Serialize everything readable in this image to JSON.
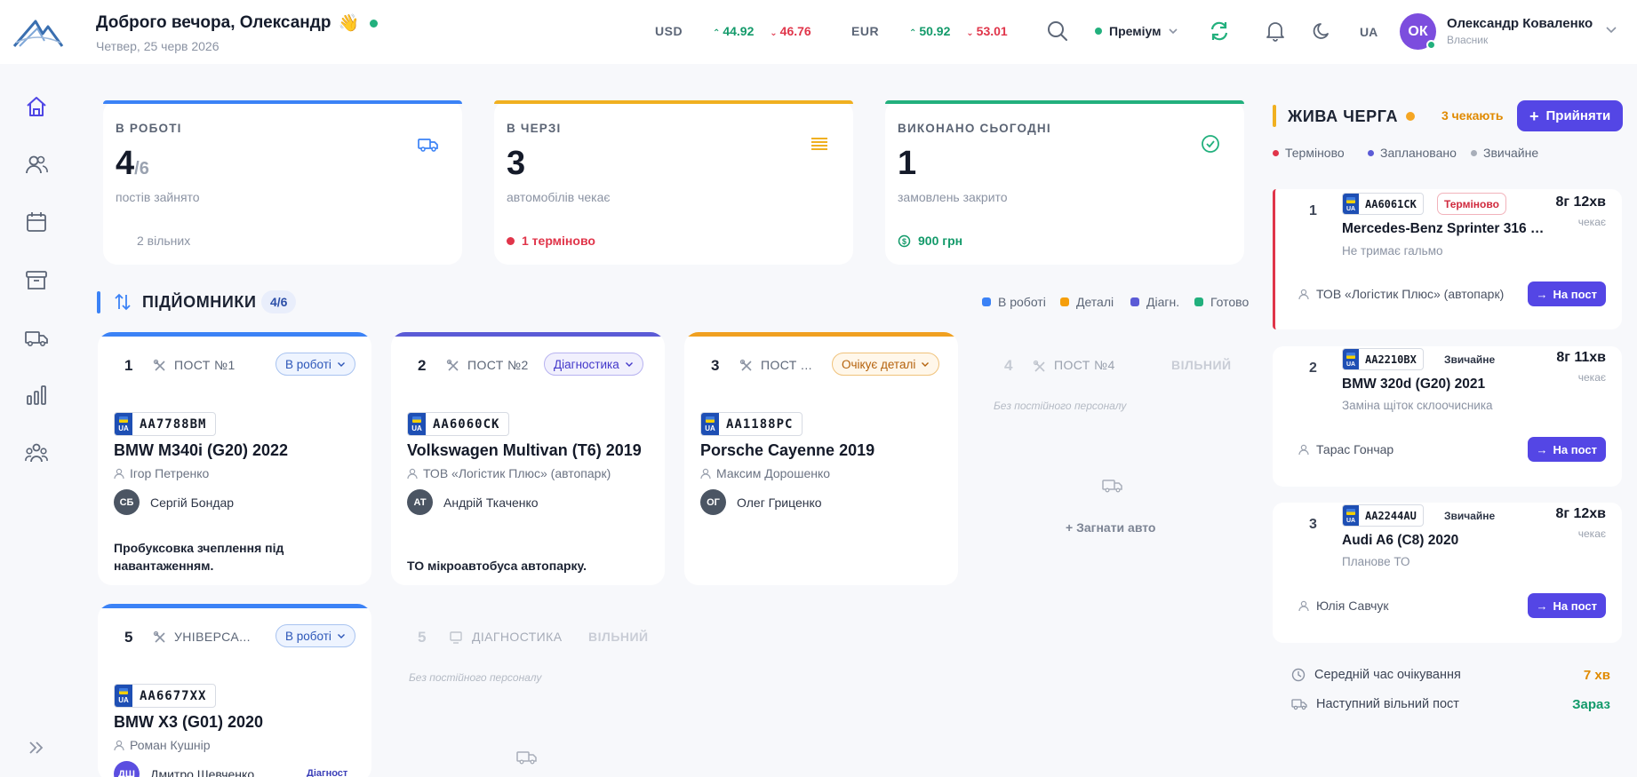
{
  "header": {
    "greeting": "Доброго вечора, Олександр",
    "wave": "👋",
    "date": "Четвер, 25 черв 2026",
    "currencies": [
      {
        "code": "USD",
        "buy": "44.92",
        "sell": "46.76"
      },
      {
        "code": "EUR",
        "buy": "50.92",
        "sell": "53.01"
      }
    ],
    "plan": "Преміум",
    "lang": "UA",
    "user": {
      "initials": "ОК",
      "name": "Олександр Коваленко",
      "role": "Власник"
    }
  },
  "stats": [
    {
      "label": "В РОБОТІ",
      "value": "4",
      "total": "/6",
      "sub": "постів зайнято",
      "foot": "2 вільних",
      "color": "#3b82f6",
      "icon": "truck-icon"
    },
    {
      "label": "В ЧЕРЗІ",
      "value": "3",
      "total": "",
      "sub": "автомобілів чекає",
      "foot": "1 терміново",
      "color": "#f0b020",
      "icon": "queue-list-icon"
    },
    {
      "label": "ВИКОНАНО СЬОГОДНІ",
      "value": "1",
      "total": "",
      "sub": "замовлень закрито",
      "foot": "900 грн",
      "color": "#22b07d",
      "icon": "check-circle-icon"
    }
  ],
  "lifts": {
    "title": "ПІДЙОМНИКИ",
    "count": "4/6",
    "legend": [
      "В роботі",
      "Деталі",
      "Діагн.",
      "Готово"
    ],
    "legend_colors": [
      "#3b82f6",
      "#f59e0b",
      "#5b5bd6",
      "#22b07d"
    ],
    "posts": [
      {
        "num": "1",
        "name": "ПОСТ №1",
        "status": "В роботі",
        "plate": "AA7788BM",
        "car": "BMW M340i (G20) 2022",
        "owner": "Ігор Петренко",
        "mech_initials": "СБ",
        "mech": "Сергій Бондар",
        "note": "Пробуксовка зчеплення під навантаженням."
      },
      {
        "num": "2",
        "name": "ПОСТ №2",
        "status": "Діагностика",
        "plate": "AA6060CK",
        "car": "Volkswagen Multivan (T6) 2019",
        "owner": "ТОВ «Логістик Плюс» (автопарк)",
        "mech_initials": "АТ",
        "mech": "Андрій Ткаченко",
        "note": "ТО мікроавтобуса автопарку."
      },
      {
        "num": "3",
        "name": "ПОСТ ...",
        "status": "Очікує деталі",
        "plate": "AA1188PC",
        "car": "Porsche Cayenne 2019",
        "owner": "Максим Дорошенко",
        "mech_initials": "ОГ",
        "mech": "Олег Гриценко",
        "note": ""
      },
      {
        "num": "5",
        "name": "УНІВЕРСА...",
        "status": "В роботі",
        "plate": "AA6677XX",
        "car": "BMW X3 (G01) 2020",
        "owner": "Роман Кушнір",
        "mech_initials": "ДШ",
        "mech": "Дмитро Шевченко",
        "tag": "Діагност"
      }
    ],
    "empty_posts": [
      {
        "num": "4",
        "name": "ПОСТ №4",
        "status": "ВІЛЬНИЙ",
        "staff": "Без постійного персоналу",
        "action": "+ Загнати авто"
      },
      {
        "num": "5",
        "name": "ДІАГНОСТИКА",
        "status": "ВІЛЬНИЙ",
        "staff": "Без постійного персоналу"
      }
    ]
  },
  "queue": {
    "title": "ЖИВА ЧЕРГА",
    "waiting": "3 чекають",
    "accept": "Прийняти",
    "legend": [
      "Терміново",
      "Заплановано",
      "Звичайне"
    ],
    "items": [
      {
        "idx": "1",
        "plate": "AA6061CK",
        "priority": "Терміново",
        "time": "8г 12хв",
        "wait_label": "чекає",
        "car": "Mercedes-Benz Sprinter 316 2...",
        "desc": "Не тримає гальмо",
        "client": "ТОВ «Логістик Плюс» (автопарк)",
        "btn": "На пост"
      },
      {
        "idx": "2",
        "plate": "AA2210BX",
        "priority": "Звичайне",
        "time": "8г 11хв",
        "wait_label": "чекає",
        "car": "BMW 320d (G20) 2021",
        "desc": "Заміна щіток склоочисника",
        "client": "Тарас Гончар",
        "btn": "На пост"
      },
      {
        "idx": "3",
        "plate": "AA2244AU",
        "priority": "Звичайне",
        "time": "8г 12хв",
        "wait_label": "чекає",
        "car": "Audi A6 (C8) 2020",
        "desc": "Планове ТО",
        "client": "Юлія Савчук",
        "btn": "На пост"
      }
    ],
    "avg_wait_label": "Середній час очікування",
    "avg_wait": "7 хв",
    "next_free_label": "Наступний вільний пост",
    "next_free": "Зараз"
  }
}
